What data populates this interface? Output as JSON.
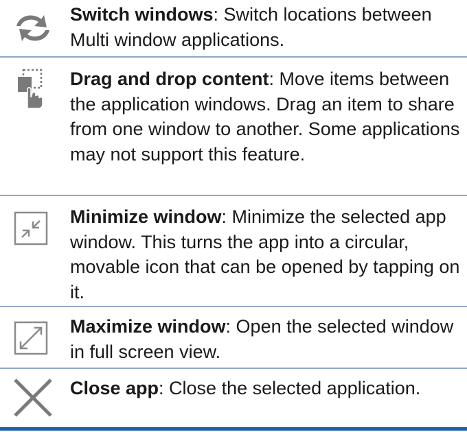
{
  "items": [
    {
      "icon": "switch-windows-icon",
      "title": "Switch windows",
      "description": ": Switch locations between Multi window applications."
    },
    {
      "icon": "drag-and-drop-icon",
      "title": "Drag and drop content",
      "description": ": Move items between the application windows. Drag an item to share from one window to another. Some applications may not support this feature."
    },
    {
      "icon": "minimize-window-icon",
      "title": "Minimize window",
      "description": ": Minimize the selected app window. This turns the app into a circular, movable icon that can be opened by tapping on it."
    },
    {
      "icon": "maximize-window-icon",
      "title": "Maximize window",
      "description": ": Open the selected window in full screen view."
    },
    {
      "icon": "close-icon",
      "title": "Close app",
      "description": ": Close the selected application."
    }
  ],
  "colors": {
    "divider": "#8fa8c4",
    "bottom_rule": "#1f5fa6",
    "icon_gray": "#7a7a7a"
  }
}
